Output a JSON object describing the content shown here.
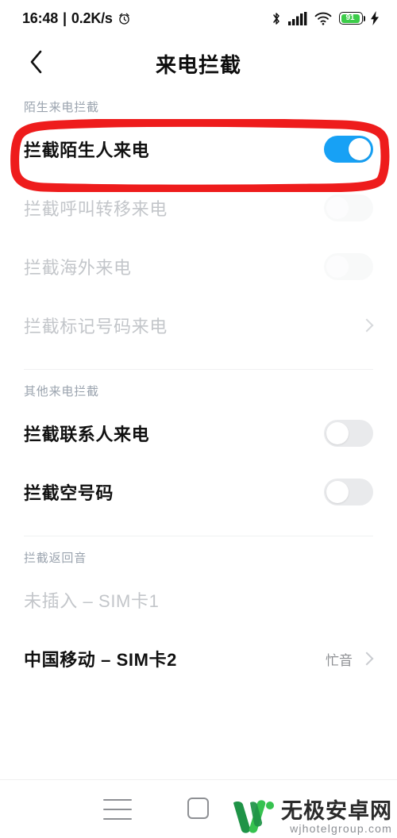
{
  "status_bar": {
    "time": "16:48",
    "separator": "|",
    "network_speed": "0.2K/s",
    "alarm_icon": "alarm-clock-icon",
    "bluetooth_icon": "bluetooth-icon",
    "signal_icon": "cellular-signal-icon",
    "wifi_icon": "wifi-icon",
    "battery_level": "91",
    "battery_color": "#3ccc49",
    "charging_icon": "lightning-bolt-icon"
  },
  "header": {
    "back_icon": "back-chevron-icon",
    "title": "来电拦截"
  },
  "sections": [
    {
      "header": "陌生来电拦截",
      "rows": [
        {
          "label": "拦截陌生人来电",
          "control": "toggle",
          "state": "on",
          "disabled": false
        },
        {
          "label": "拦截呼叫转移来电",
          "control": "toggle",
          "state": "off",
          "disabled": true
        },
        {
          "label": "拦截海外来电",
          "control": "toggle",
          "state": "off",
          "disabled": true
        },
        {
          "label": "拦截标记号码来电",
          "control": "chevron",
          "state": "",
          "disabled": true
        }
      ]
    },
    {
      "header": "其他来电拦截",
      "rows": [
        {
          "label": "拦截联系人来电",
          "control": "toggle",
          "state": "off",
          "disabled": false
        },
        {
          "label": "拦截空号码",
          "control": "toggle",
          "state": "off",
          "disabled": false
        }
      ]
    },
    {
      "header": "拦截返回音",
      "rows": [
        {
          "label": "未插入 – SIM卡1",
          "control": "none",
          "state": "",
          "disabled": true
        },
        {
          "label": "中国移动 – SIM卡2",
          "control": "chevron",
          "value": "忙音",
          "disabled": false
        }
      ]
    }
  ],
  "annotation": {
    "shape": "red-rectangle-highlight",
    "color": "#ee1c1c",
    "target": "拦截陌生人来电"
  },
  "nav_bar": {
    "recents_icon": "recents-hamburger-icon",
    "home_icon": "home-square-icon"
  },
  "watermark": {
    "logo_icon": "w-logo-icon",
    "logo_color_dark": "#1f9347",
    "logo_color_light": "#36c24f",
    "site_name": "无极安卓网",
    "site_url": "wjhotelgroup.com"
  },
  "accent": {
    "toggle_on": "#17a1f5",
    "toggle_off": "#e9eaec"
  }
}
